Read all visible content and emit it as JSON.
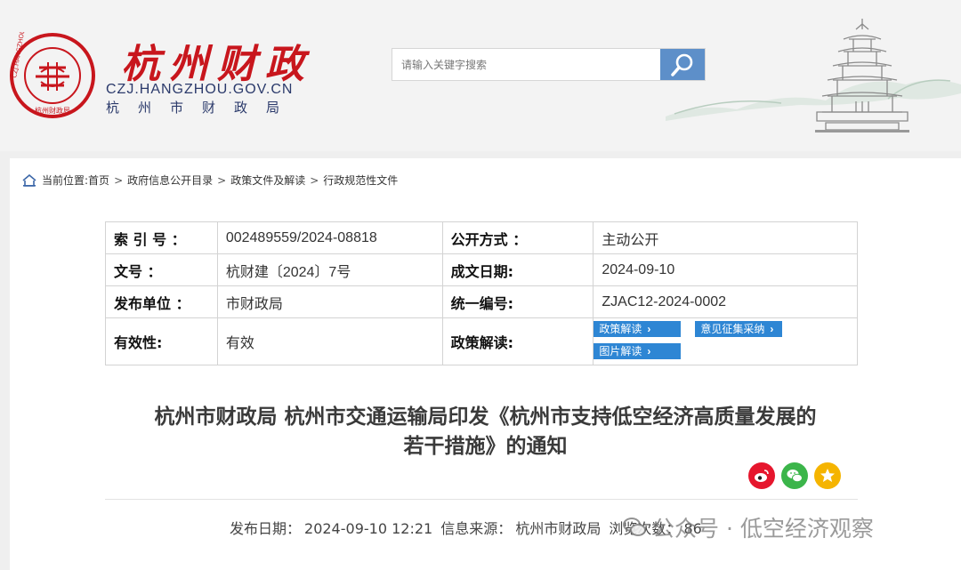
{
  "header": {
    "logo_text": "杭州财政",
    "logo_url": "CZJ.HANGZHOU.GOV.CN",
    "logo_org": "杭州市财政局",
    "seal_ring_text": "CZJ.HANGZHOU.GOV.CN",
    "seal_bottom_text": "杭州财政局",
    "search_placeholder": "请输入关键字搜索"
  },
  "breadcrumb": {
    "prefix": "当前位置:",
    "items": [
      "首页",
      "政府信息公开目录",
      "政策文件及解读",
      "行政规范性文件"
    ]
  },
  "meta": {
    "index_label": "索 引 号 ：",
    "index_value": "002489559/2024-08818",
    "open_label": "公开方式 ：",
    "open_value": "主动公开",
    "doc_label": "文号 ：",
    "doc_value": "杭财建〔2024〕7号",
    "date_label": "成文日期:",
    "date_value": "2024-09-10",
    "issuer_label": "发布单位 ：",
    "issuer_value": "市财政局",
    "unified_label": "统一编号:",
    "unified_value": "ZJAC12-2024-0002",
    "validity_label": "有效性:",
    "validity_value": "有效",
    "policy_label": "政策解读:",
    "tags": [
      "政策解读",
      "意见征集采纳",
      "图片解读"
    ]
  },
  "article": {
    "title_line1": "杭州市财政局 杭州市交通运输局印发《杭州市支持低空经济高质量发展的",
    "title_line2": "若干措施》的通知",
    "pub_date_label": "发布日期：",
    "pub_date": "2024-09-10 12:21",
    "source_label": "信息来源：",
    "source": "杭州市财政局",
    "views_label": "浏览次数：",
    "views": "86"
  },
  "watermark": "公众号 · 低空经济观察",
  "colors": {
    "brand_red": "#c8161d",
    "brand_navy": "#2b3a6b",
    "search_blue": "#5d8fc9",
    "tag_blue": "#2e86d4"
  },
  "icons": [
    "search-icon",
    "home-icon",
    "weibo-icon",
    "wechat-icon",
    "star-icon"
  ]
}
